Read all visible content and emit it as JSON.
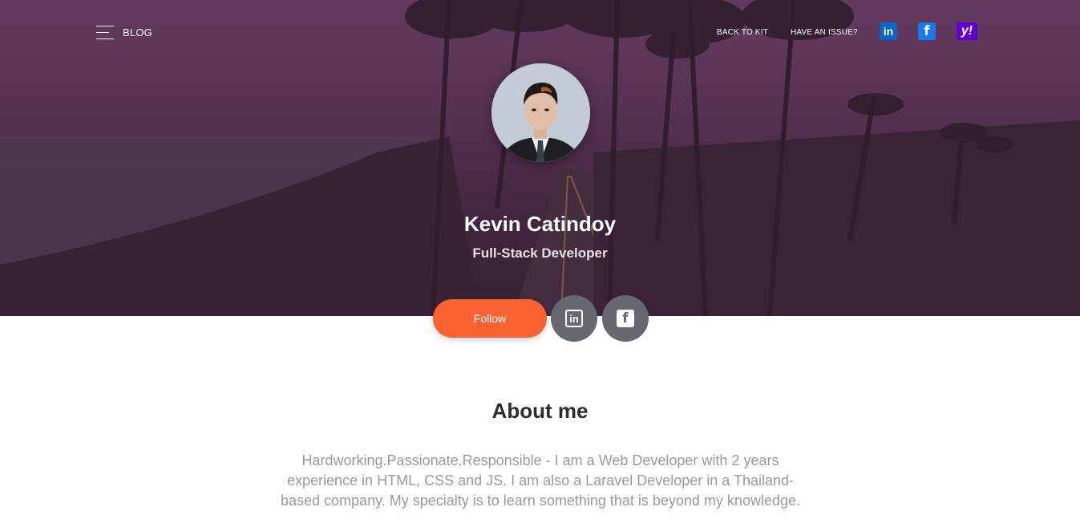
{
  "nav": {
    "brand": "BLOG",
    "links": [
      {
        "label": "BACK TO KIT"
      },
      {
        "label": "HAVE AN ISSUE?"
      }
    ],
    "social": [
      {
        "icon": "linkedin-icon",
        "glyph": "in",
        "color": "#0a66c2"
      },
      {
        "icon": "facebook-icon",
        "glyph": "f",
        "color": "#1877f2"
      },
      {
        "icon": "yahoo-icon",
        "glyph": "y!",
        "color": "#6001d2"
      }
    ]
  },
  "profile": {
    "name": "Kevin Catindoy",
    "title": "Full-Stack Developer",
    "follow_label": "Follow",
    "buttons": [
      {
        "icon": "linkedin-icon",
        "glyph": "in"
      },
      {
        "icon": "facebook-icon",
        "glyph": "f"
      }
    ]
  },
  "about": {
    "heading": "About me",
    "text": "Hardworking.Passionate.Responsible - I am a Web Developer with 2 years experience in HTML, CSS and JS. I am also a Laravel Developer in a Thailand-based company. My specialty is to learn something that is beyond my knowledge."
  },
  "colors": {
    "accent": "#f96332",
    "round_button": "#666a70",
    "hero_overlay": "#5a3556"
  }
}
